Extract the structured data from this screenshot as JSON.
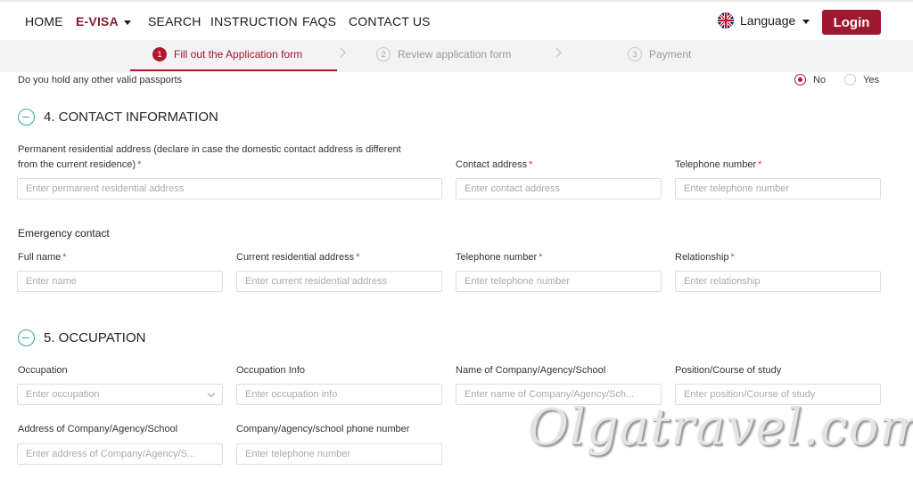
{
  "nav": {
    "items": [
      "HOME",
      "E-VISA",
      "SEARCH",
      "INSTRUCTION",
      "FAQS",
      "CONTACT US"
    ],
    "language_label": "Language",
    "login_label": "Login"
  },
  "stepper": {
    "steps": [
      {
        "num": "1",
        "label": "Fill out the Application form"
      },
      {
        "num": "2",
        "label": "Review application form"
      },
      {
        "num": "3",
        "label": "Payment"
      }
    ]
  },
  "passports": {
    "question": "Do you hold any other valid passports",
    "options": [
      "No",
      "Yes"
    ],
    "selected": "No"
  },
  "contact": {
    "title": "4. CONTACT INFORMATION",
    "permanent_label_line1": "Permanent residential address (declare in case the domestic contact address is different",
    "permanent_label_line2": "from the current residence)",
    "permanent_placeholder": "Enter permanent residential address",
    "contact_label": "Contact address",
    "contact_placeholder": "Enter contact address",
    "phone_label": "Telephone number",
    "phone_placeholder": "Enter telephone number",
    "emergency_title": "Emergency contact",
    "em_name_label": "Full name",
    "em_name_placeholder": "Enter name",
    "em_address_label": "Current residential address",
    "em_address_placeholder": "Enter current residential address",
    "em_phone_label": "Telephone number",
    "em_phone_placeholder": "Enter telephone number",
    "em_rel_label": "Relationship",
    "em_rel_placeholder": "Enter relationship"
  },
  "occupation": {
    "title": "5. OCCUPATION",
    "occ_label": "Occupation",
    "occ_placeholder": "Enter occupation",
    "info_label": "Occupation Info",
    "info_placeholder": "Enter occupation info",
    "company_label": "Name of Company/Agency/School",
    "company_placeholder": "Enter name of Company/Agency/Sch...",
    "position_label": "Position/Course of study",
    "position_placeholder": "Enter position/Course of study",
    "address_label": "Address of Company/Agency/School",
    "address_placeholder": "Enter address of Company/Agency/S...",
    "cphone_label": "Company/agency/school phone number",
    "cphone_placeholder": "Enter telephone number"
  },
  "required_mark": "*",
  "watermark": "Olgatravel.com",
  "colors": {
    "brand": "#9e1830",
    "accent": "#3aa6a6",
    "required": "#d23a4a"
  }
}
